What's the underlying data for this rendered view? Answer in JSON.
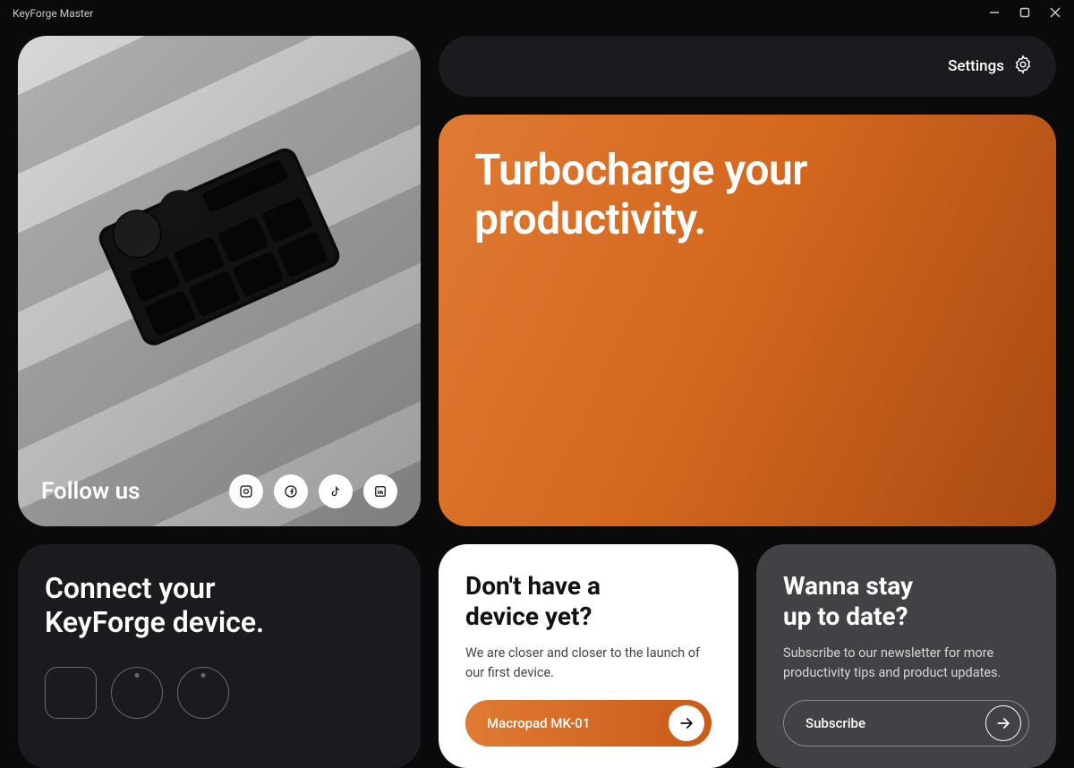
{
  "app": {
    "title": "KeyForge Master"
  },
  "settings": {
    "label": "Settings"
  },
  "hero": {
    "headline_l1": "Turbocharge your",
    "headline_l2": "productivity."
  },
  "follow": {
    "title": "Follow us",
    "socials": [
      "instagram-icon",
      "facebook-icon",
      "tiktok-icon",
      "linkedin-icon"
    ]
  },
  "connect": {
    "title_l1": "Connect your",
    "title_l2": "KeyForge device."
  },
  "device_promo": {
    "title_l1": "Don't have a",
    "title_l2": "device yet?",
    "body": "We are closer and closer to the launch of our first device.",
    "cta": "Macropad MK-01"
  },
  "newsletter": {
    "title_l1": "Wanna stay",
    "title_l2": "up to date?",
    "body": "Subscribe to our newsletter for more productivity tips and product updates.",
    "cta": "Subscribe"
  }
}
